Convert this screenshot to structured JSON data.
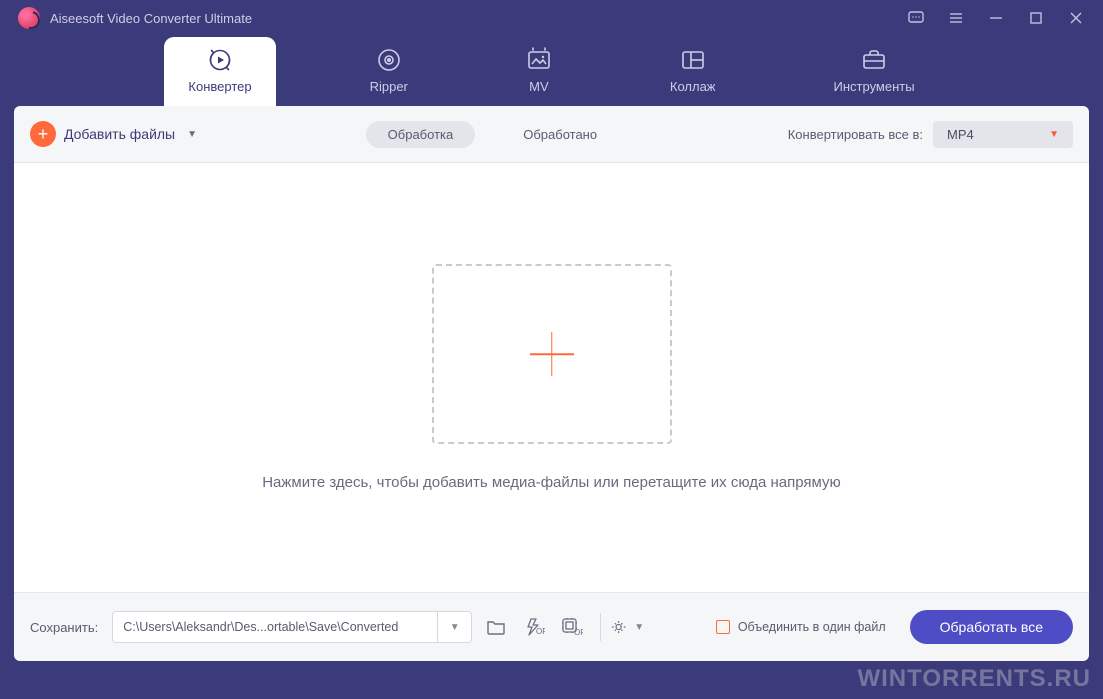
{
  "app": {
    "title": "Aiseesoft Video Converter Ultimate"
  },
  "tabs": {
    "converter": "Конвертер",
    "ripper": "Ripper",
    "mv": "MV",
    "collage": "Коллаж",
    "toolbox": "Инструменты"
  },
  "toolbar": {
    "add_files": "Добавить файлы",
    "processing": "Обработка",
    "processed": "Обработано",
    "convert_all_to": "Конвертировать все в:",
    "format": "MP4"
  },
  "dropzone": {
    "hint": "Нажмите здесь, чтобы добавить медиа-файлы или перетащите их сюда напрямую"
  },
  "bottom": {
    "save_label": "Сохранить:",
    "path": "C:\\Users\\Aleksandr\\Des...ortable\\Save\\Converted",
    "merge": "Объединить в один файл",
    "convert_all": "Обработать все"
  },
  "watermark": "WINTORRENTS.RU"
}
